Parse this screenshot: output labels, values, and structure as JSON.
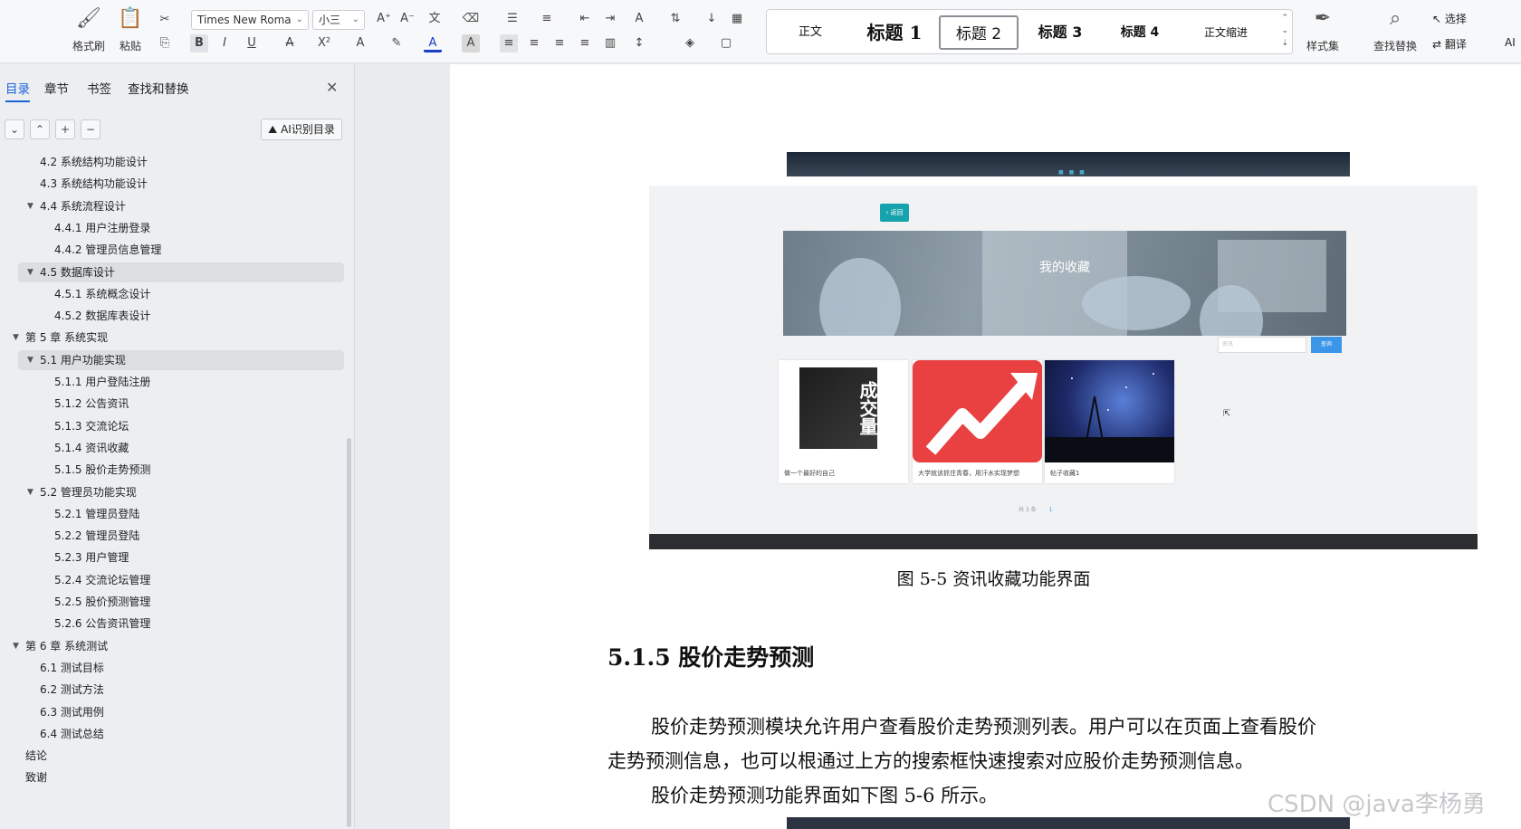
{
  "ribbon": {
    "format_painter": "格式刷",
    "paste": "粘贴",
    "font_name": "Times New Roma",
    "font_size": "小三",
    "styles": [
      "正文",
      "标题 1",
      "标题 2",
      "标题 3",
      "标题 4",
      "正文缩进"
    ],
    "style_set": "样式集",
    "find_replace": "查找替换",
    "select": "选择",
    "translate": "翻译",
    "ai": "AI"
  },
  "sidebar": {
    "tabs": [
      "目录",
      "章节",
      "书签",
      "查找和替换"
    ],
    "ai_button": "AI识别目录",
    "toc": [
      {
        "label": "4.2  系统结构功能设计",
        "level": 2
      },
      {
        "label": "4.3  系统结构功能设计",
        "level": 2
      },
      {
        "label": "4.4  系统流程设计",
        "level": 2,
        "expanded": true
      },
      {
        "label": "4.4.1  用户注册登录",
        "level": 3
      },
      {
        "label": "4.4.2 管理员信息管理",
        "level": 3
      },
      {
        "label": "4.5 数据库设计",
        "level": 2,
        "expanded": true,
        "highlighted": true
      },
      {
        "label": "4.5.1  系统概念设计",
        "level": 3
      },
      {
        "label": "4.5.2  数据库表设计",
        "level": 3
      },
      {
        "label": "第 5 章  系统实现",
        "level": 1,
        "expanded": true
      },
      {
        "label": "5.1  用户功能实现",
        "level": 2,
        "expanded": true,
        "highlighted": true
      },
      {
        "label": "5.1.1  用户登陆注册",
        "level": 3
      },
      {
        "label": "5.1.2  公告资讯",
        "level": 3
      },
      {
        "label": "5.1.3  交流论坛",
        "level": 3
      },
      {
        "label": "5.1.4  资讯收藏",
        "level": 3
      },
      {
        "label": "5.1.5  股价走势预测",
        "level": 3
      },
      {
        "label": "5.2  管理员功能实现",
        "level": 2,
        "expanded": true
      },
      {
        "label": "5.2.1 管理员登陆",
        "level": 3
      },
      {
        "label": "5.2.2 管理员登陆",
        "level": 3
      },
      {
        "label": "5.2.3 用户管理",
        "level": 3
      },
      {
        "label": "5.2.4  交流论坛管理",
        "level": 3
      },
      {
        "label": "5.2.5  股价预测管理",
        "level": 3
      },
      {
        "label": "5.2.6  公告资讯管理",
        "level": 3
      },
      {
        "label": "第 6 章  系统测试",
        "level": 1,
        "expanded": true
      },
      {
        "label": "6.1  测试目标",
        "level": 2
      },
      {
        "label": "6.2  测试方法",
        "level": 2
      },
      {
        "label": "6.3  测试用例",
        "level": 2
      },
      {
        "label": "6.4  测试总结",
        "level": 2
      },
      {
        "label": "结论",
        "level": 1
      },
      {
        "label": "致谢",
        "level": 1
      }
    ]
  },
  "screenshot": {
    "back_button": "返回",
    "banner_title": "我的收藏",
    "search_placeholder": "资讯",
    "search_button": "查询",
    "cards": [
      {
        "caption": "做一个最好的自己",
        "cover_text": "成交量"
      },
      {
        "caption": "大学就该抓住青春，用汗水实现梦想"
      },
      {
        "caption": "帖子收藏1"
      }
    ],
    "pager_total": "共 3 条",
    "pager_current": "1"
  },
  "document": {
    "figure_caption": "图 5-5  资讯收藏功能界面",
    "section_heading": "5.1.5  股价走势预测",
    "paragraphs": [
      "股价走势预测模块允许用户查看股价走势预测列表。用户可以在页面上查看股价",
      "走势预测信息，也可以根通过上方的搜索框快速搜索对应股价走势预测信息。",
      "股价走势预测功能界面如下图 5-6 所示。"
    ]
  },
  "watermark": "CSDN @java李杨勇",
  "colors": {
    "accent": "#1a64d8",
    "teal": "#16a3ad",
    "search_blue": "#3b95e8"
  }
}
